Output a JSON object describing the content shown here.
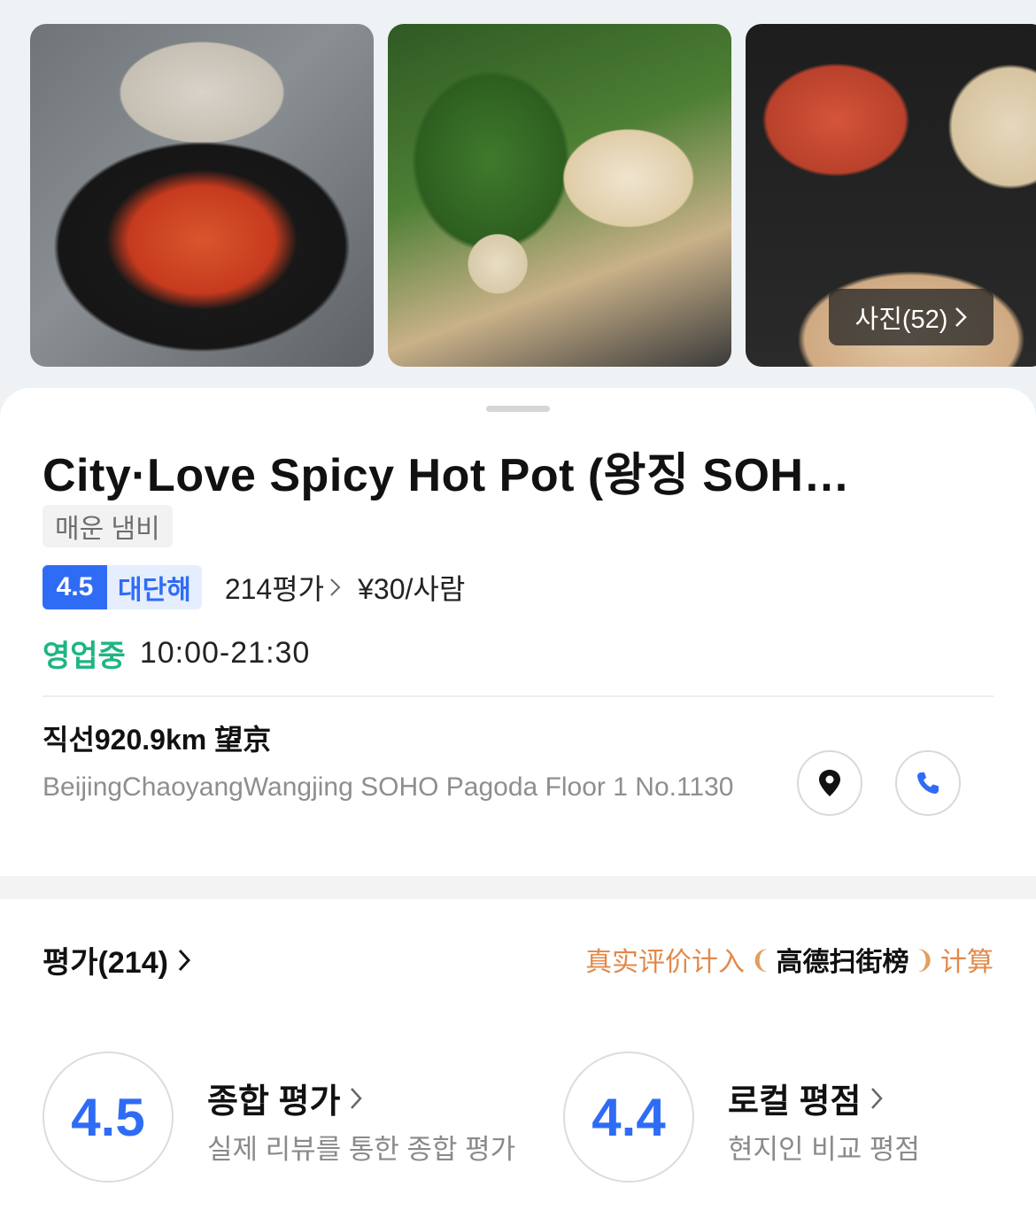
{
  "photos": {
    "count_label": "사진(52)"
  },
  "restaurant": {
    "name": "City·Love Spicy Hot Pot (왕징 SOH…",
    "category": "매운 냄비",
    "rating": "4.5",
    "rating_word": "대단해",
    "review_count_label": "214평가",
    "price": "¥30/사람",
    "status": "영업중",
    "hours": "10:00-21:30",
    "distance": "직선920.9km 望京",
    "address": "BeijingChaoyangWangjing SOHO Pagoda Floor 1 No.1130"
  },
  "reviews": {
    "heading": "평가(214)",
    "ranking_prefix": "真实评价计入",
    "ranking_brand": "高德扫街榜",
    "ranking_suffix": "计算",
    "overall_score": "4.5",
    "overall_title": "종합 평가",
    "overall_desc": "실제 리뷰를 통한 종합 평가",
    "local_score": "4.4",
    "local_title": "로컬 평점",
    "local_desc": "현지인 비교 평점"
  },
  "icons": {
    "location": "map-pin-icon",
    "phone": "phone-icon",
    "chevron": "chevron-right-icon"
  },
  "colors": {
    "accent": "#2f6cf5",
    "open": "#1fb582",
    "ranking": "#e1894b"
  }
}
